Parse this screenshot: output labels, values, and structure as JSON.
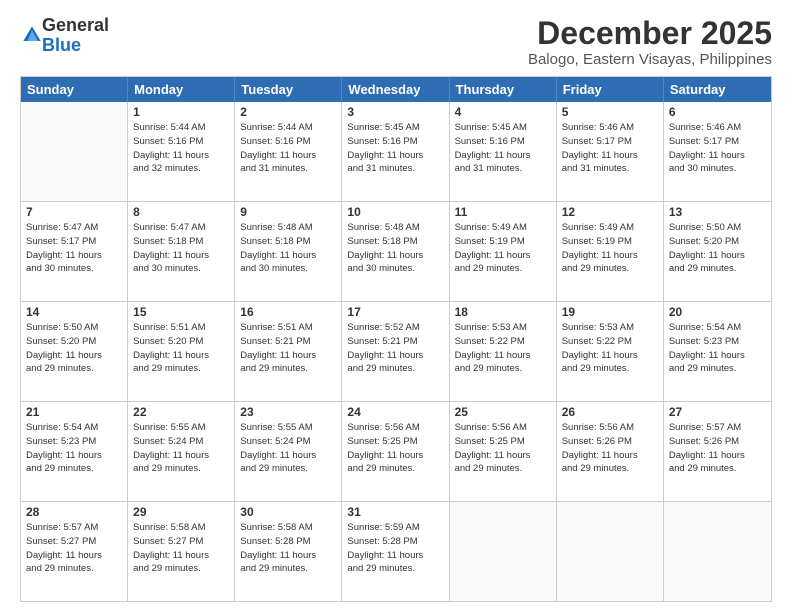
{
  "logo": {
    "general": "General",
    "blue": "Blue"
  },
  "title": "December 2025",
  "subtitle": "Balogo, Eastern Visayas, Philippines",
  "days": [
    "Sunday",
    "Monday",
    "Tuesday",
    "Wednesday",
    "Thursday",
    "Friday",
    "Saturday"
  ],
  "weeks": [
    [
      {
        "day": "",
        "sunrise": "",
        "sunset": "",
        "daylight": "",
        "empty": true
      },
      {
        "day": "1",
        "sunrise": "Sunrise: 5:44 AM",
        "sunset": "Sunset: 5:16 PM",
        "daylight": "Daylight: 11 hours and 32 minutes."
      },
      {
        "day": "2",
        "sunrise": "Sunrise: 5:44 AM",
        "sunset": "Sunset: 5:16 PM",
        "daylight": "Daylight: 11 hours and 31 minutes."
      },
      {
        "day": "3",
        "sunrise": "Sunrise: 5:45 AM",
        "sunset": "Sunset: 5:16 PM",
        "daylight": "Daylight: 11 hours and 31 minutes."
      },
      {
        "day": "4",
        "sunrise": "Sunrise: 5:45 AM",
        "sunset": "Sunset: 5:16 PM",
        "daylight": "Daylight: 11 hours and 31 minutes."
      },
      {
        "day": "5",
        "sunrise": "Sunrise: 5:46 AM",
        "sunset": "Sunset: 5:17 PM",
        "daylight": "Daylight: 11 hours and 31 minutes."
      },
      {
        "day": "6",
        "sunrise": "Sunrise: 5:46 AM",
        "sunset": "Sunset: 5:17 PM",
        "daylight": "Daylight: 11 hours and 30 minutes."
      }
    ],
    [
      {
        "day": "7",
        "sunrise": "Sunrise: 5:47 AM",
        "sunset": "Sunset: 5:17 PM",
        "daylight": "Daylight: 11 hours and 30 minutes."
      },
      {
        "day": "8",
        "sunrise": "Sunrise: 5:47 AM",
        "sunset": "Sunset: 5:18 PM",
        "daylight": "Daylight: 11 hours and 30 minutes."
      },
      {
        "day": "9",
        "sunrise": "Sunrise: 5:48 AM",
        "sunset": "Sunset: 5:18 PM",
        "daylight": "Daylight: 11 hours and 30 minutes."
      },
      {
        "day": "10",
        "sunrise": "Sunrise: 5:48 AM",
        "sunset": "Sunset: 5:18 PM",
        "daylight": "Daylight: 11 hours and 30 minutes."
      },
      {
        "day": "11",
        "sunrise": "Sunrise: 5:49 AM",
        "sunset": "Sunset: 5:19 PM",
        "daylight": "Daylight: 11 hours and 29 minutes."
      },
      {
        "day": "12",
        "sunrise": "Sunrise: 5:49 AM",
        "sunset": "Sunset: 5:19 PM",
        "daylight": "Daylight: 11 hours and 29 minutes."
      },
      {
        "day": "13",
        "sunrise": "Sunrise: 5:50 AM",
        "sunset": "Sunset: 5:20 PM",
        "daylight": "Daylight: 11 hours and 29 minutes."
      }
    ],
    [
      {
        "day": "14",
        "sunrise": "Sunrise: 5:50 AM",
        "sunset": "Sunset: 5:20 PM",
        "daylight": "Daylight: 11 hours and 29 minutes."
      },
      {
        "day": "15",
        "sunrise": "Sunrise: 5:51 AM",
        "sunset": "Sunset: 5:20 PM",
        "daylight": "Daylight: 11 hours and 29 minutes."
      },
      {
        "day": "16",
        "sunrise": "Sunrise: 5:51 AM",
        "sunset": "Sunset: 5:21 PM",
        "daylight": "Daylight: 11 hours and 29 minutes."
      },
      {
        "day": "17",
        "sunrise": "Sunrise: 5:52 AM",
        "sunset": "Sunset: 5:21 PM",
        "daylight": "Daylight: 11 hours and 29 minutes."
      },
      {
        "day": "18",
        "sunrise": "Sunrise: 5:53 AM",
        "sunset": "Sunset: 5:22 PM",
        "daylight": "Daylight: 11 hours and 29 minutes."
      },
      {
        "day": "19",
        "sunrise": "Sunrise: 5:53 AM",
        "sunset": "Sunset: 5:22 PM",
        "daylight": "Daylight: 11 hours and 29 minutes."
      },
      {
        "day": "20",
        "sunrise": "Sunrise: 5:54 AM",
        "sunset": "Sunset: 5:23 PM",
        "daylight": "Daylight: 11 hours and 29 minutes."
      }
    ],
    [
      {
        "day": "21",
        "sunrise": "Sunrise: 5:54 AM",
        "sunset": "Sunset: 5:23 PM",
        "daylight": "Daylight: 11 hours and 29 minutes."
      },
      {
        "day": "22",
        "sunrise": "Sunrise: 5:55 AM",
        "sunset": "Sunset: 5:24 PM",
        "daylight": "Daylight: 11 hours and 29 minutes."
      },
      {
        "day": "23",
        "sunrise": "Sunrise: 5:55 AM",
        "sunset": "Sunset: 5:24 PM",
        "daylight": "Daylight: 11 hours and 29 minutes."
      },
      {
        "day": "24",
        "sunrise": "Sunrise: 5:56 AM",
        "sunset": "Sunset: 5:25 PM",
        "daylight": "Daylight: 11 hours and 29 minutes."
      },
      {
        "day": "25",
        "sunrise": "Sunrise: 5:56 AM",
        "sunset": "Sunset: 5:25 PM",
        "daylight": "Daylight: 11 hours and 29 minutes."
      },
      {
        "day": "26",
        "sunrise": "Sunrise: 5:56 AM",
        "sunset": "Sunset: 5:26 PM",
        "daylight": "Daylight: 11 hours and 29 minutes."
      },
      {
        "day": "27",
        "sunrise": "Sunrise: 5:57 AM",
        "sunset": "Sunset: 5:26 PM",
        "daylight": "Daylight: 11 hours and 29 minutes."
      }
    ],
    [
      {
        "day": "28",
        "sunrise": "Sunrise: 5:57 AM",
        "sunset": "Sunset: 5:27 PM",
        "daylight": "Daylight: 11 hours and 29 minutes."
      },
      {
        "day": "29",
        "sunrise": "Sunrise: 5:58 AM",
        "sunset": "Sunset: 5:27 PM",
        "daylight": "Daylight: 11 hours and 29 minutes."
      },
      {
        "day": "30",
        "sunrise": "Sunrise: 5:58 AM",
        "sunset": "Sunset: 5:28 PM",
        "daylight": "Daylight: 11 hours and 29 minutes."
      },
      {
        "day": "31",
        "sunrise": "Sunrise: 5:59 AM",
        "sunset": "Sunset: 5:28 PM",
        "daylight": "Daylight: 11 hours and 29 minutes."
      },
      {
        "day": "",
        "sunrise": "",
        "sunset": "",
        "daylight": "",
        "empty": true
      },
      {
        "day": "",
        "sunrise": "",
        "sunset": "",
        "daylight": "",
        "empty": true
      },
      {
        "day": "",
        "sunrise": "",
        "sunset": "",
        "daylight": "",
        "empty": true
      }
    ]
  ]
}
